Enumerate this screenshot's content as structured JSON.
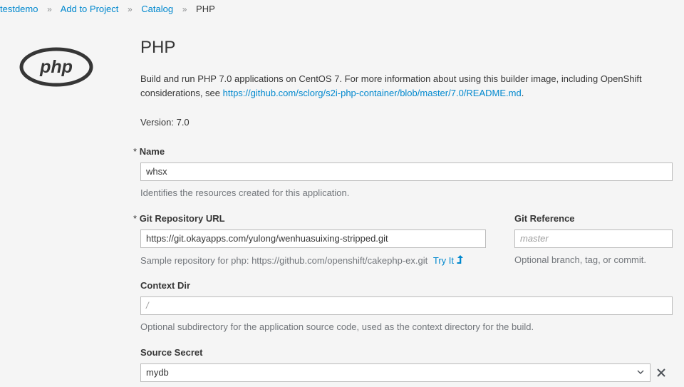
{
  "breadcrumb": {
    "items": [
      "testdemo",
      "Add to Project",
      "Catalog"
    ],
    "current": "PHP",
    "separator": "»"
  },
  "logo": {
    "text": "php"
  },
  "page_title": "PHP",
  "description": {
    "text": "Build and run PHP 7.0 applications on CentOS 7. For more information about using this builder image, including OpenShift considerations, see ",
    "link": "https://github.com/sclorg/s2i-php-container/blob/master/7.0/README.md",
    "suffix": "."
  },
  "version": "Version: 7.0",
  "name_field": {
    "required_mark": "*",
    "label": "Name",
    "value": "whsx",
    "help": "Identifies the resources created for this application."
  },
  "git_url_field": {
    "required_mark": "*",
    "label": "Git Repository URL",
    "value": "https://git.okayapps.com/yulong/wenhuasuixing-stripped.git",
    "help": "Sample repository for php: https://github.com/openshift/cakephp-ex.git",
    "try_it": "Try It"
  },
  "git_ref_field": {
    "label": "Git Reference",
    "placeholder": "master",
    "help": "Optional branch, tag, or commit."
  },
  "context_dir_field": {
    "label": "Context Dir",
    "placeholder": "/",
    "help": "Optional subdirectory for the application source code, used as the context directory for the build."
  },
  "source_secret_field": {
    "label": "Source Secret",
    "value": "mydb"
  },
  "colors": {
    "link": "#0088ce",
    "text": "#363636",
    "help": "#72767b",
    "background": "#f5f5f5"
  }
}
